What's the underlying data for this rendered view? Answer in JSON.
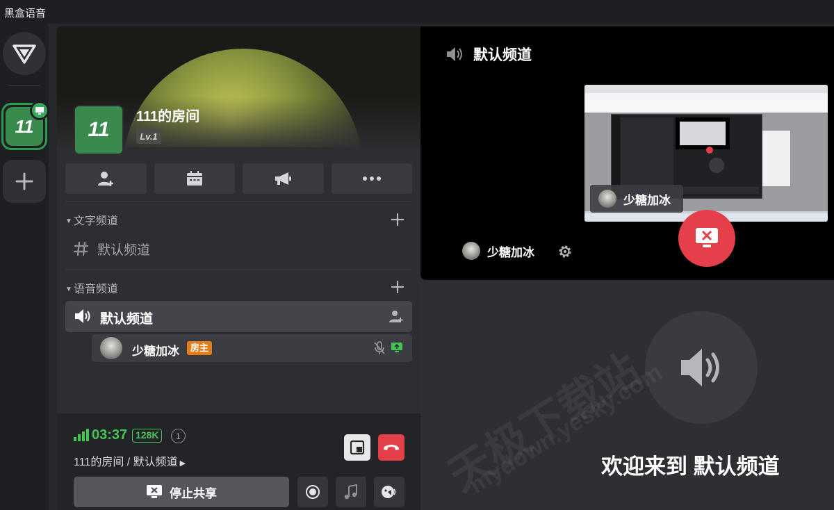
{
  "app": {
    "title": "黑盒语音"
  },
  "rail": {
    "servers": [
      {
        "label": "11"
      }
    ]
  },
  "room": {
    "avatar_text": "11",
    "name": "111的房间",
    "level": "Lv.1"
  },
  "categories": {
    "text": {
      "label": "文字频道",
      "channels": [
        {
          "name": "默认频道"
        }
      ]
    },
    "voice": {
      "label": "语音频道",
      "channels": [
        {
          "name": "默认频道"
        }
      ]
    }
  },
  "member": {
    "name": "少糖加冰",
    "role": "房主"
  },
  "status": {
    "time": "03:37",
    "bitrate": "128K",
    "count": "1",
    "location": "111的房间 / 默认频道",
    "stop_share_label": "停止共享"
  },
  "stage": {
    "channel_title": "默认频道",
    "presenter": "少糖加冰",
    "welcome": "欢迎来到 默认频道"
  },
  "watermark": {
    "cn": "天极下载站",
    "url": "mydown.yesky.com"
  },
  "colors": {
    "accent_green": "#45c454",
    "room_green": "#3a8a4d",
    "danger": "#e5404a",
    "host_badge": "#e27d17"
  }
}
